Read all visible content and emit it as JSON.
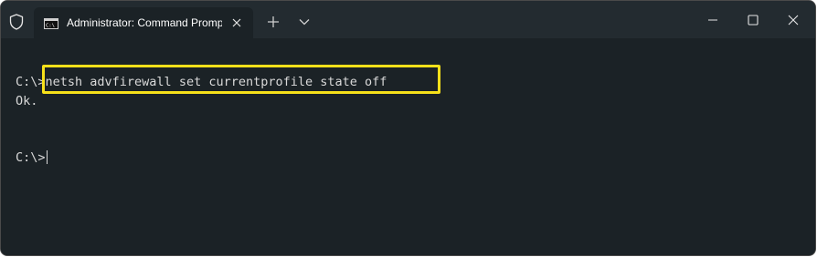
{
  "titlebar": {
    "tab_title": "Administrator: Command Prompt",
    "icons": {
      "shield": "shield-icon",
      "tab": "command-prompt-icon",
      "close_tab": "close-icon",
      "new_tab": "plus-icon",
      "dropdown": "chevron-down-icon",
      "minimize": "minimize-icon",
      "maximize": "maximize-icon",
      "close": "close-icon"
    }
  },
  "console": {
    "lines": [
      {
        "prompt": "C:\\>",
        "command": "netsh advfirewall set currentprofile state off"
      },
      {
        "output": "Ok."
      },
      {
        "prompt": "C:\\>",
        "command": ""
      }
    ]
  },
  "colors": {
    "background": "#1b2226",
    "titlebar": "#232b30",
    "text": "#d9d9d9",
    "highlight": "#f6e01a"
  }
}
